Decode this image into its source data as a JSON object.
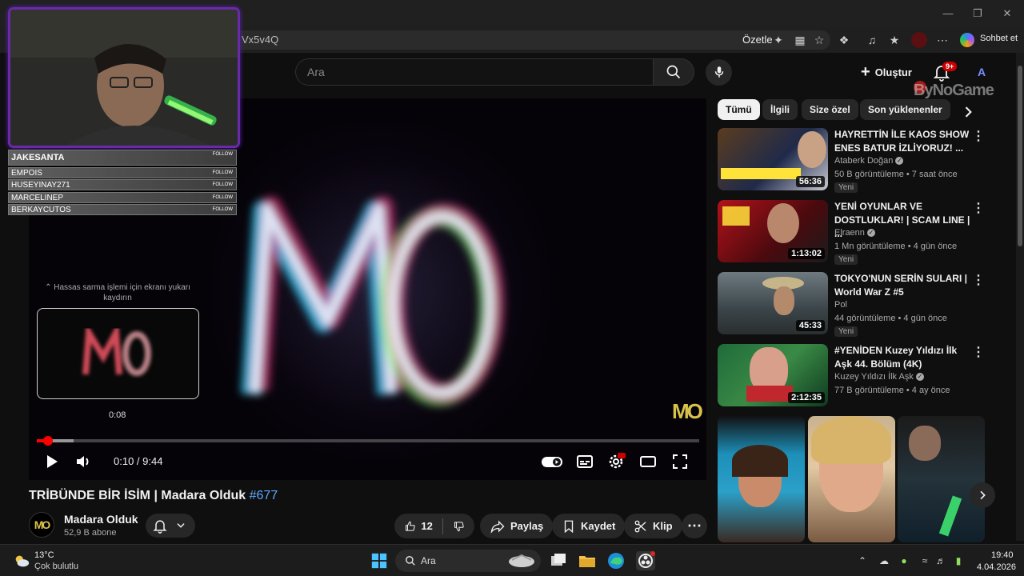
{
  "browser": {
    "url_fragment": "Vx5v4Q",
    "summarize_label": "Özetle",
    "chat_label": "Sohbet et"
  },
  "header": {
    "search_placeholder": "Ara",
    "create_label": "Oluştur",
    "notification_count": "9+",
    "avatar_letter": "A",
    "watermark": "ByNoGame"
  },
  "stream_overlay": {
    "followers": [
      {
        "name": "JAKESANTA",
        "action": "FOLLOW"
      },
      {
        "name": "EMPOIS",
        "action": "FOLLOW"
      },
      {
        "name": "HUSEYINAY271",
        "action": "FOLLOW"
      },
      {
        "name": "MARCELINEP",
        "action": "FOLLOW"
      },
      {
        "name": "BERKAYCUTOS",
        "action": "FOLLOW"
      }
    ]
  },
  "player": {
    "scroll_hint": "⌃ Hassas sarma işlemi için ekranı yukarı kaydırın",
    "preview_time": "0:08",
    "time_display": "0:10 / 9:44",
    "progress_fraction": 0.017,
    "corner_logo": "MO"
  },
  "video": {
    "title": "TRİBÜNDE BİR İSİM | Madara Olduk",
    "hashtag": "#677",
    "channel_name": "Madara Olduk",
    "subscribers": "52,9 B abone",
    "channel_logo": "MO",
    "like_count": "12",
    "share_label": "Paylaş",
    "save_label": "Kaydet",
    "clip_label": "Klip"
  },
  "sidebar": {
    "chips": [
      "Tümü",
      "İlgili",
      "Size özel",
      "Son yüklenenler"
    ],
    "recommendations": [
      {
        "title": "HAYRETTİN İLE KAOS SHOW ENES BATUR İZLİYORUZ! ...",
        "channel": "Ataberk Doğan",
        "verified": true,
        "meta": "50 B görüntüleme • 7 saat önce",
        "badge": "Yeni",
        "duration": "56:36"
      },
      {
        "title": "YENİ OYUNLAR VE DOSTLUKLAR! | SCAM LINE | ...",
        "channel": "Elraenn",
        "verified": true,
        "meta": "1 Mn görüntüleme • 4 gün önce",
        "badge": "Yeni",
        "duration": "1:13:02"
      },
      {
        "title": "TOKYO'NUN SERİN SULARI | World War Z #5",
        "channel": "Pol",
        "verified": false,
        "meta": "44 görüntüleme • 4 gün önce",
        "badge": "Yeni",
        "duration": "45:33"
      },
      {
        "title": "#YENİDEN Kuzey Yıldızı İlk Aşk 44. Bölüm (4K)",
        "channel": "Kuzey Yıldızı İlk Aşk",
        "verified": true,
        "meta": "77 B görüntüleme • 4 ay önce",
        "badge": "",
        "duration": "2:12:35"
      }
    ]
  },
  "taskbar": {
    "temperature": "13°C",
    "weather": "Çok bulutlu",
    "search_label": "Ara",
    "time": "19:40",
    "date": "4.04.2026"
  },
  "colors": {
    "accent_red": "#ff0000",
    "stream_frame": "#6a2aa8",
    "hashtag_blue": "#5fa8ff"
  }
}
